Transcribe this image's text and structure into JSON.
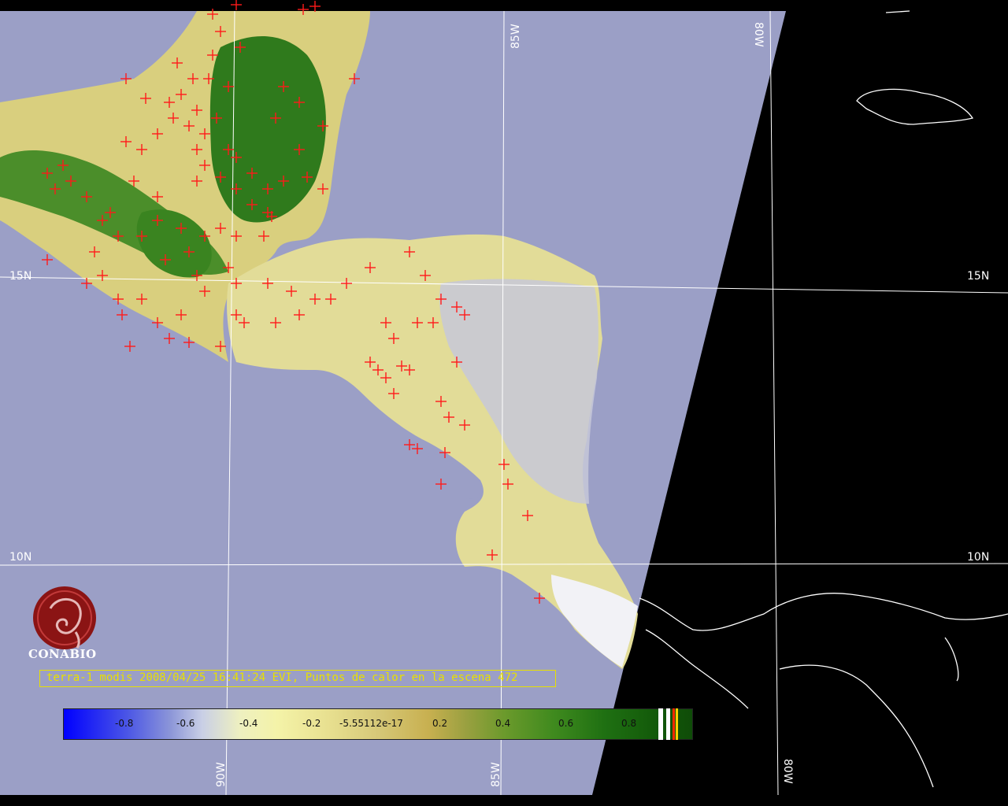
{
  "map": {
    "graticule_labels": {
      "top_85w": "85W",
      "top_80w": "80W",
      "left_15n": "15N",
      "right_15n": "15N",
      "left_10n": "10N",
      "right_10n": "10N",
      "bottom_90w": "90W",
      "bottom_85w": "85W",
      "bottom_80w": "80W"
    },
    "colors": {
      "ocean": "#9b9fc6",
      "no_data": "#000000",
      "hotspot": "#ff1a1a",
      "grid": "#ffffff",
      "caption": "#e8e000"
    }
  },
  "logo": {
    "text": "CONABIO",
    "icon": "conabio-seal-icon"
  },
  "caption": "terra-1 modis 2008/04/25 16:41:24 EVI, Puntos de calor en la escena 472",
  "colorbar": {
    "labels": [
      "-0.8",
      "-0.6",
      "-0.4",
      "-0.2",
      "-5.55112e-17",
      "0.2",
      "0.4",
      "0.6",
      "0.8"
    ]
  }
}
